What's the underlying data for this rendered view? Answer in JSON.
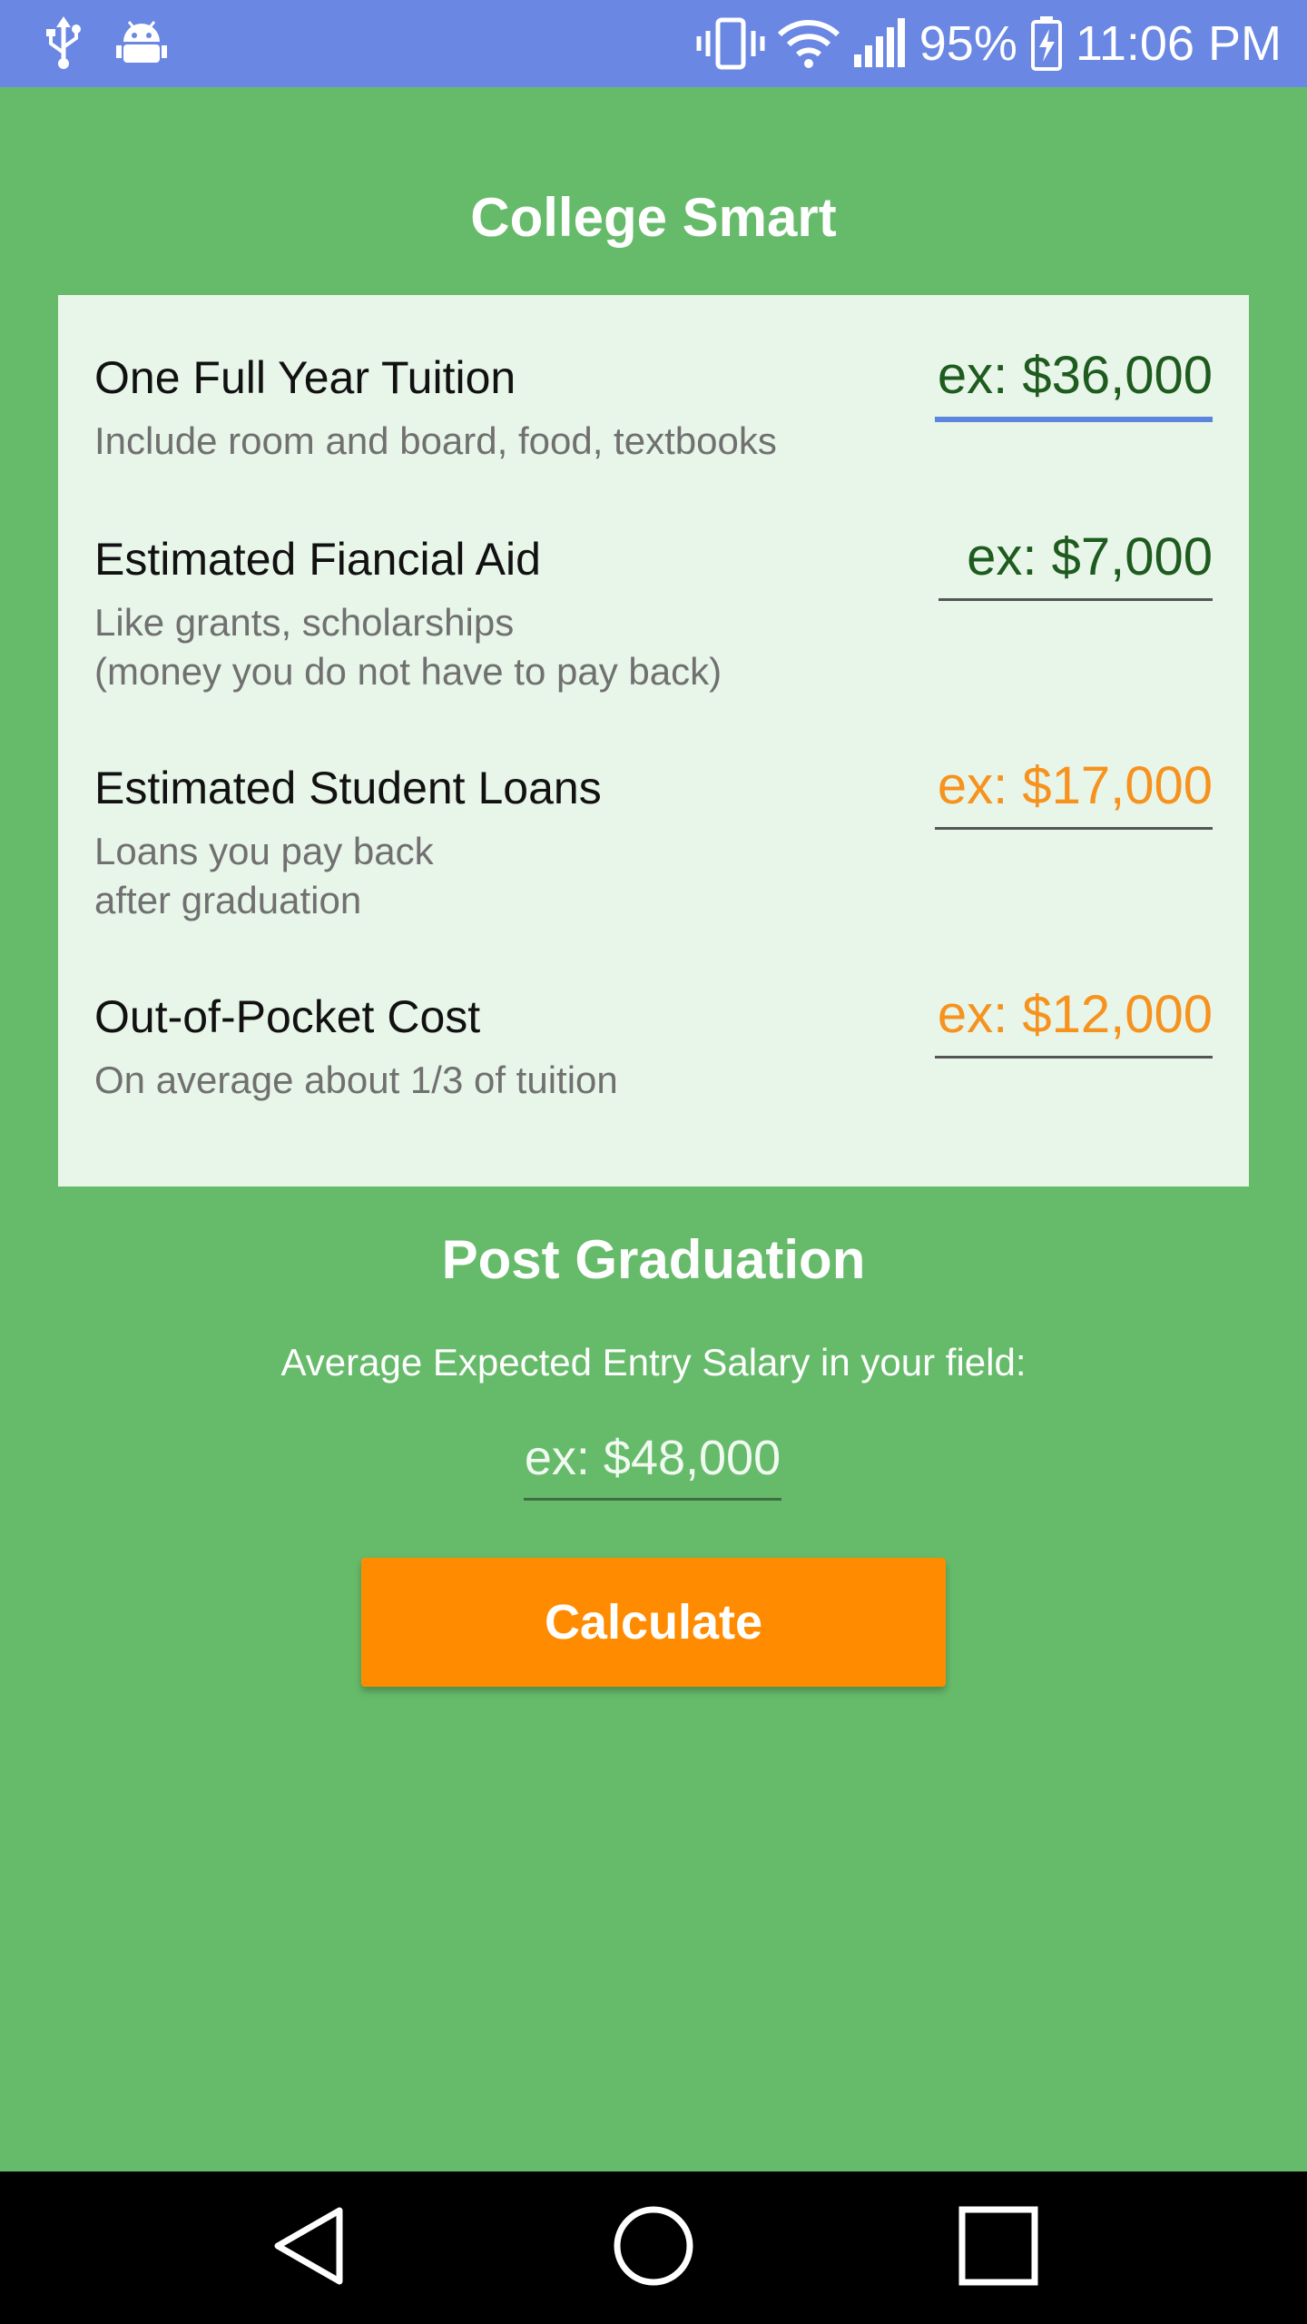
{
  "status_bar": {
    "battery": "95%",
    "time": "11:06 PM",
    "icons": [
      "usb-icon",
      "android-debug-icon",
      "vibrate-icon",
      "wifi-icon",
      "signal-icon",
      "battery-charging-icon"
    ]
  },
  "app": {
    "title": "College Smart"
  },
  "costs": {
    "tuition": {
      "label": "One Full Year Tuition",
      "sub": "Include room and board, food, textbooks",
      "placeholder": "ex: $36,000"
    },
    "aid": {
      "label": "Estimated Fiancial Aid",
      "sub": "Like grants, scholarships\n(money you do not have to pay back)",
      "placeholder": "ex: $7,000"
    },
    "loans": {
      "label": "Estimated Student Loans",
      "sub": "Loans you pay back\nafter graduation",
      "placeholder": "ex: $17,000"
    },
    "out_of_pocket": {
      "label": "Out-of-Pocket Cost",
      "sub": "On average about 1/3 of tuition",
      "placeholder": "ex: $12,000"
    }
  },
  "post_graduation": {
    "title": "Post Graduation",
    "salary_label": "Average Expected Entry Salary in your field:",
    "salary_placeholder": "ex: $48,000"
  },
  "actions": {
    "calculate": "Calculate"
  },
  "colors": {
    "background": "#66BB6A",
    "status_bar": "#6987E3",
    "card": "#E8F5E9",
    "accent_orange": "#FF8C00",
    "field_green": "#1E5B1E",
    "field_orange": "#F6921E",
    "focus_underline": "#5C86DE"
  },
  "nav_bar": {
    "icons": [
      "back-icon",
      "home-icon",
      "recents-icon"
    ]
  }
}
